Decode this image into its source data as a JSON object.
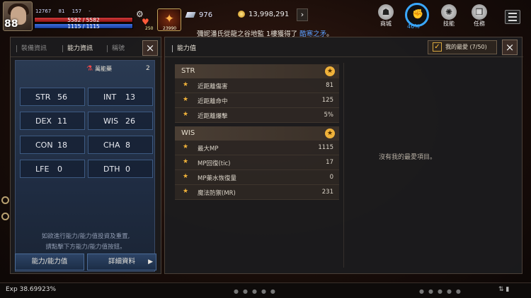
{
  "hud": {
    "level": "88",
    "stats_line": [
      "12767",
      "81",
      "157",
      "-"
    ],
    "hp": "5582 / 5582",
    "mp": "1115 / 1115",
    "potion_count": "250",
    "skill_count": "23990",
    "crystal": "976",
    "gold": "13,998,291",
    "gold_arrow": "›",
    "notice_prefix": "彌妮潘氏從龍之谷地監 1樓獲得了 ",
    "notice_item": "酷寒之矛",
    "notice_suffix": "。",
    "shop": "商城",
    "growth_pct": "46%",
    "skills": "技能",
    "quests": "任務"
  },
  "left_panel": {
    "tabs": [
      "裝備資訊",
      "能力資訊",
      "稱號"
    ],
    "close": "×",
    "elixir_label": "萬能藥",
    "elixir_count": "2",
    "stats": [
      {
        "name": "STR",
        "value": "56"
      },
      {
        "name": "INT",
        "value": "13"
      },
      {
        "name": "DEX",
        "value": "11"
      },
      {
        "name": "WIS",
        "value": "26"
      },
      {
        "name": "CON",
        "value": "18"
      },
      {
        "name": "CHA",
        "value": "8"
      },
      {
        "name": "LFE",
        "value": "0"
      },
      {
        "name": "DTH",
        "value": "0"
      }
    ],
    "info_line1": "如欲進行能力/能力值投資及重置,",
    "info_line2": "請點擊下方能力/能力值按鈕。",
    "btn_ability": "能力/能力值",
    "btn_detail": "詳細資料",
    "btn_detail_arrow": "▶"
  },
  "right_panel": {
    "title": "能力值",
    "fav_label": "我的最愛 (7/50)",
    "close": "×",
    "no_fav": "沒有我的最愛項目。",
    "sections": [
      {
        "title": "STR",
        "rows": [
          {
            "label": "近距離傷害",
            "value": "81"
          },
          {
            "label": "近距離命中",
            "value": "125"
          },
          {
            "label": "近距離爆擊",
            "value": "5%"
          }
        ]
      },
      {
        "title": "WIS",
        "rows": [
          {
            "label": "最大MP",
            "value": "1115"
          },
          {
            "label": "MP回復(tic)",
            "value": "17"
          },
          {
            "label": "MP藥水恢復量",
            "value": "0"
          },
          {
            "label": "魔法防禦(MR)",
            "value": "231"
          }
        ]
      }
    ]
  },
  "bottom": {
    "exp": "Exp 38.69923%"
  },
  "colors": {
    "accent_gold": "#f0b23a",
    "hp_red": "#d23a3a",
    "mp_blue": "#3d6fe0",
    "link_blue": "#5aa0ff"
  }
}
